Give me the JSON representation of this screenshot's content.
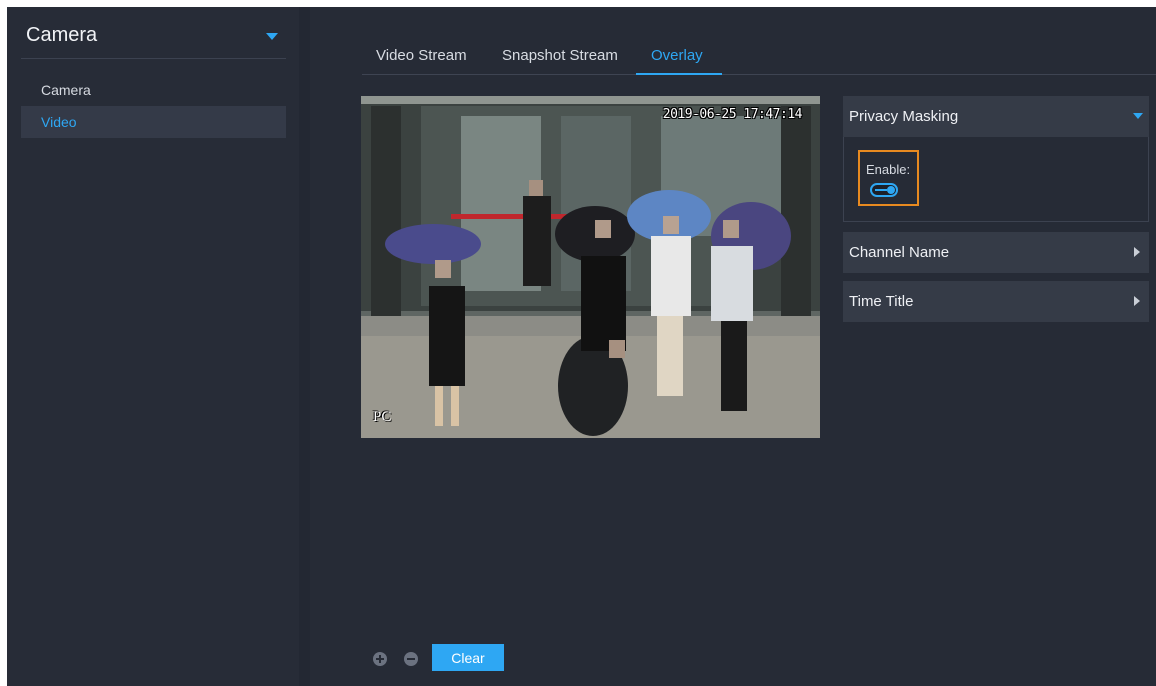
{
  "sidebar": {
    "title": "Camera",
    "items": [
      {
        "label": "Camera",
        "active": false
      },
      {
        "label": "Video",
        "active": true
      }
    ]
  },
  "tabs": [
    {
      "label": "Video Stream",
      "active": false
    },
    {
      "label": "Snapshot Stream",
      "active": false
    },
    {
      "label": "Overlay",
      "active": true
    }
  ],
  "video": {
    "timestamp": "2019-06-25 17:47:14",
    "channel_label": "PC"
  },
  "panels": [
    {
      "title": "Privacy Masking",
      "expanded": true,
      "enable_label": "Enable:",
      "enabled": true
    },
    {
      "title": "Channel Name",
      "expanded": false
    },
    {
      "title": "Time Title",
      "expanded": false
    }
  ],
  "toolbar": {
    "clear_label": "Clear"
  },
  "colors": {
    "accent": "#2ea7f3",
    "highlight": "#e88a20",
    "sidebar_bg": "#272c37",
    "main_bg": "#262b36"
  }
}
